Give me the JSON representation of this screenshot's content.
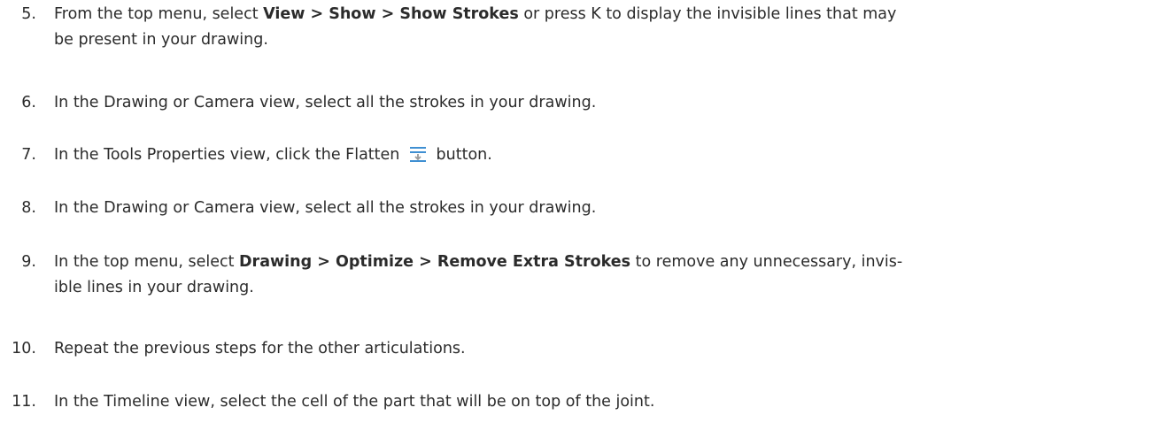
{
  "steps": [
    {
      "number": "5.",
      "line1_pre": "From the top menu, select ",
      "line1_bold": "View > Show > Show Strokes",
      "line1_post": " or press K to display the invisible lines that may",
      "line2": "be present in your drawing."
    },
    {
      "number": "6.",
      "text": "In the Drawing or Camera view, select all the strokes in your drawing."
    },
    {
      "number": "7.",
      "pre": "In the Tools Properties view, click the Flatten",
      "icon": "flatten-icon",
      "post": "button."
    },
    {
      "number": "8.",
      "text": "In the Drawing or Camera view, select all the strokes in your drawing."
    },
    {
      "number": "9.",
      "line1_pre": "In the top menu, select ",
      "line1_bold": "Drawing > Optimize > Remove Extra Strokes",
      "line1_post": " to remove any unnecessary, invis-",
      "line2": "ible lines in your drawing."
    },
    {
      "number": "10.",
      "text": "Repeat the previous steps for the other articulations."
    },
    {
      "number": "11.",
      "text": "In the Timeline view, select the cell of the part that will be on top of the joint."
    }
  ]
}
